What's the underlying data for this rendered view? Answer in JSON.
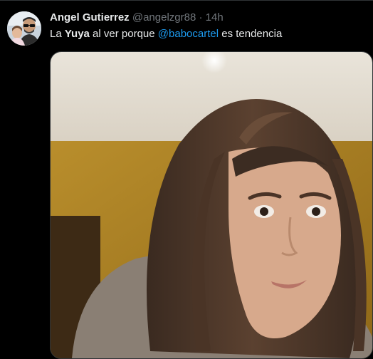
{
  "tweet": {
    "author_name": "Angel Gutierrez",
    "author_handle": "@angelzgr88",
    "separator": "·",
    "time": "14h",
    "text_parts": {
      "t1": "La ",
      "t2": "Yuya",
      "t3": " al ver porque ",
      "mention": "@babocartel",
      "t4": " es tendencia"
    },
    "media": {
      "type": "photo"
    }
  },
  "colors": {
    "background": "#000000",
    "primary_text": "#e7e9ea",
    "secondary_text": "#71767b",
    "link": "#1d9bf0",
    "border": "#2f3336"
  }
}
